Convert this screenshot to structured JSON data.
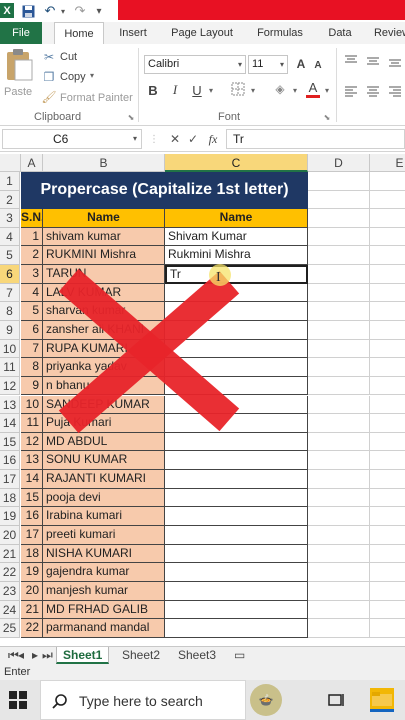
{
  "quick_access": {
    "logo": "X",
    "save_icon": "💾",
    "undo_icon": "↶",
    "redo_icon": "↷"
  },
  "ribbon_tabs": [
    "File",
    "Home",
    "Insert",
    "Page Layout",
    "Formulas",
    "Data",
    "Review"
  ],
  "clipboard": {
    "paste": "Paste",
    "cut": "Cut",
    "copy": "Copy",
    "format_painter": "Format Painter",
    "group": "Clipboard"
  },
  "font": {
    "name": "Calibri",
    "size": "11",
    "bold": "B",
    "italic": "I",
    "underline": "U",
    "grow": "A",
    "shrink": "A",
    "color_a": "A",
    "group": "Font"
  },
  "formula_bar": {
    "name_box": "C6",
    "cancel": "✕",
    "enter": "✓",
    "fx": "fx",
    "value": "Tr"
  },
  "columns": [
    "A",
    "B",
    "C",
    "D",
    "E"
  ],
  "rows": [
    "1",
    "2",
    "3",
    "4",
    "5",
    "6",
    "7",
    "8",
    "9",
    "10",
    "11",
    "12",
    "13",
    "14",
    "15",
    "16",
    "17",
    "18",
    "19",
    "20",
    "21",
    "22",
    "23",
    "24",
    "25"
  ],
  "sheet": {
    "title": "Propercase (Capitalize 1st letter)",
    "header": {
      "sn": "S.N.",
      "name_b": "Name",
      "name_c": "Name"
    },
    "data": [
      {
        "sn": "1",
        "name": "shivam kumar",
        "proper": "Shivam Kumar"
      },
      {
        "sn": "2",
        "name": "RUKMINI Mishra",
        "proper": "Rukmini Mishra"
      },
      {
        "sn": "3",
        "name": "TARUN",
        "proper": "Tr"
      },
      {
        "sn": "4",
        "name": "LALV KUMAR",
        "proper": ""
      },
      {
        "sn": "5",
        "name": "sharvan kumar",
        "proper": ""
      },
      {
        "sn": "6",
        "name": "zansher ali KHANI",
        "proper": ""
      },
      {
        "sn": "7",
        "name": "RUPA KUMARI",
        "proper": ""
      },
      {
        "sn": "8",
        "name": "priyanka yadav",
        "proper": ""
      },
      {
        "sn": "9",
        "name": "n bhanu",
        "proper": ""
      },
      {
        "sn": "10",
        "name": "SANDEEP KUMAR",
        "proper": ""
      },
      {
        "sn": "11",
        "name": "Puja Kumari",
        "proper": ""
      },
      {
        "sn": "12",
        "name": "MD ABDUL",
        "proper": ""
      },
      {
        "sn": "13",
        "name": "SONU KUMAR",
        "proper": ""
      },
      {
        "sn": "14",
        "name": "RAJANTI KUMARI",
        "proper": ""
      },
      {
        "sn": "15",
        "name": "pooja devi",
        "proper": ""
      },
      {
        "sn": "16",
        "name": "Irabina kumari",
        "proper": ""
      },
      {
        "sn": "17",
        "name": "preeti kumari",
        "proper": ""
      },
      {
        "sn": "18",
        "name": "NISHA KUMARI",
        "proper": ""
      },
      {
        "sn": "19",
        "name": "gajendra kumar",
        "proper": ""
      },
      {
        "sn": "20",
        "name": "manjesh kumar",
        "proper": ""
      },
      {
        "sn": "21",
        "name": "MD FRHAD GALIB",
        "proper": ""
      },
      {
        "sn": "22",
        "name": "parmanand mandal",
        "proper": ""
      }
    ]
  },
  "sheet_tabs": [
    "Sheet1",
    "Sheet2",
    "Sheet3"
  ],
  "status": "Enter",
  "taskbar": {
    "search_placeholder": "Type here to search"
  },
  "colors": {
    "title_bg": "#1f3864",
    "header_bg": "#ffc000",
    "peach": "#f7caac",
    "excel_green": "#217346",
    "red_x": "#e8242a"
  }
}
